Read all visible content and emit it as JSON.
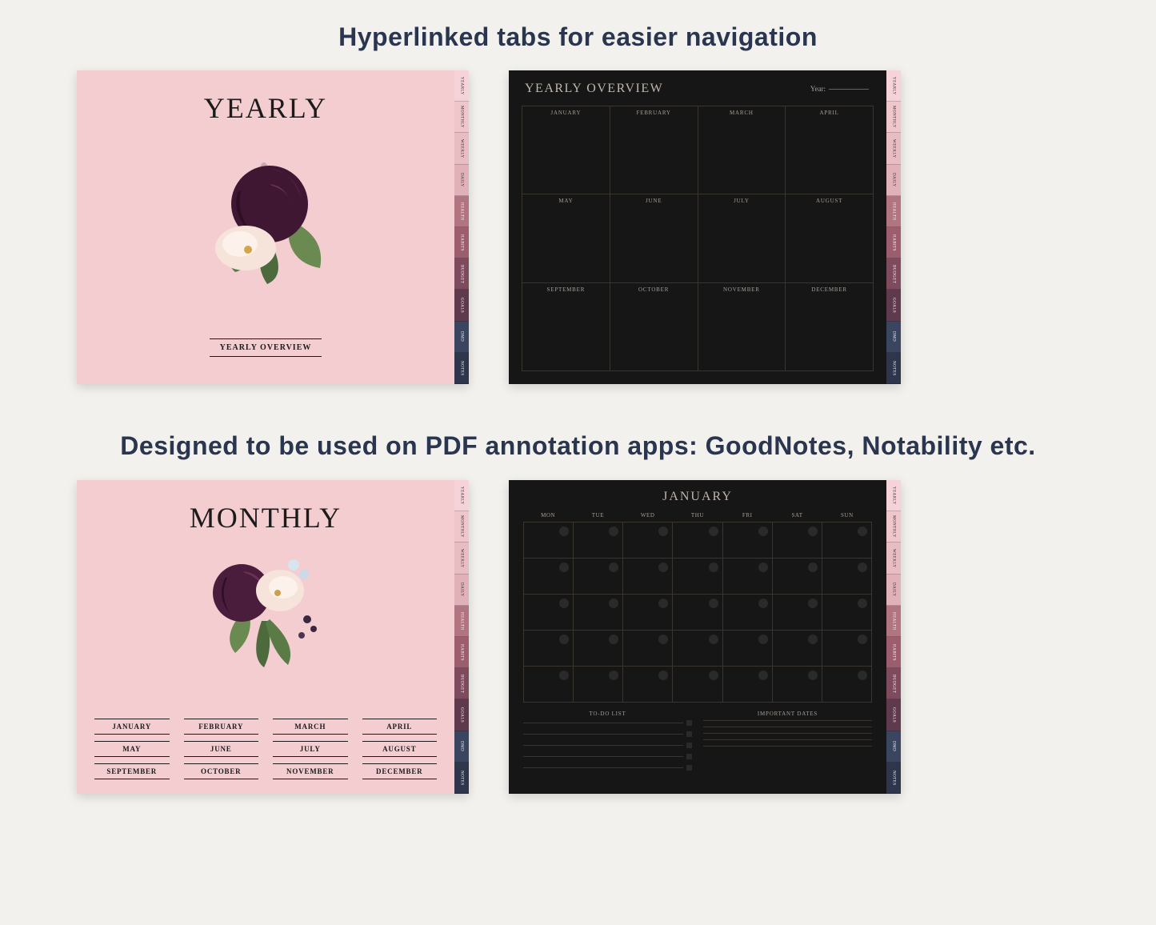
{
  "headings": {
    "top": "Hyperlinked tabs for easier navigation",
    "bottom": "Designed to be used on PDF annotation apps: GoodNotes, Notability etc."
  },
  "tabs": [
    "YEARLY",
    "MONTHLY",
    "WEEKLY",
    "DAILY",
    "HEALTH",
    "HABITS",
    "BUDGET",
    "GOALS",
    "DMD",
    "NOTES"
  ],
  "yearly_cover": {
    "title": "YEARLY",
    "link": "YEARLY OVERVIEW"
  },
  "monthly_cover": {
    "title": "MONTHLY",
    "months": [
      "JANUARY",
      "FEBRUARY",
      "MARCH",
      "APRIL",
      "MAY",
      "JUNE",
      "JULY",
      "AUGUST",
      "SEPTEMBER",
      "OCTOBER",
      "NOVEMBER",
      "DECEMBER"
    ]
  },
  "yearly_overview": {
    "title": "YEARLY OVERVIEW",
    "year_label": "Year:",
    "months": [
      "JANUARY",
      "FEBRUARY",
      "MARCH",
      "APRIL",
      "MAY",
      "JUNE",
      "JULY",
      "AUGUST",
      "SEPTEMBER",
      "OCTOBER",
      "NOVEMBER",
      "DECEMBER"
    ]
  },
  "monthly_page": {
    "title": "JANUARY",
    "days_of_week": [
      "MON",
      "TUE",
      "WED",
      "THU",
      "FRI",
      "SAT",
      "SUN"
    ],
    "todo_title": "TO-DO LIST",
    "important_title": "IMPORTANT DATES"
  }
}
